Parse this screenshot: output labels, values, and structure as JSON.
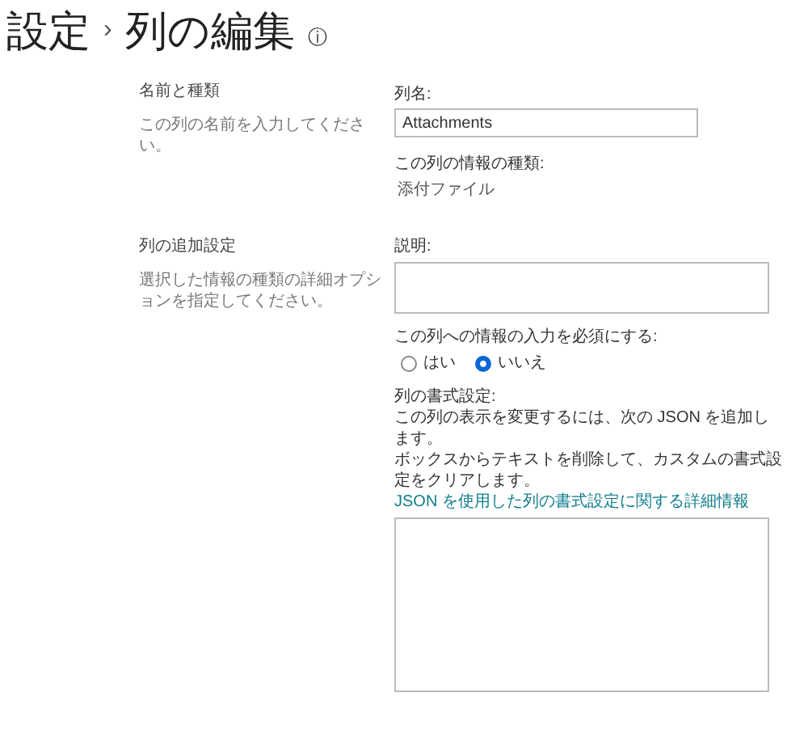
{
  "title": {
    "parent": "設定",
    "separator": "›",
    "current": "列の編集",
    "info": "ⓘ"
  },
  "sections": [
    {
      "heading": "名前と種類",
      "description": "この列の名前を入力してください。"
    },
    {
      "heading": "列の追加設定",
      "description": "選択した情報の種類の詳細オプションを指定してください。"
    }
  ],
  "column_name": {
    "label": "列名:",
    "value": "Attachments"
  },
  "column_type": {
    "label": "この列の情報の種類:",
    "value": "添付ファイル"
  },
  "description_field": {
    "label": "説明:"
  },
  "required": {
    "label": "この列への情報の入力を必須にする:",
    "options": [
      {
        "label": "はい",
        "selected": false
      },
      {
        "label": "いいえ",
        "selected": true
      }
    ]
  },
  "formatting": {
    "label": "列の書式設定:",
    "lines": [
      "この列の表示を変更するには、次の JSON を追加します。",
      "ボックスからテキストを削除して、カスタムの書式設定をクリアします。"
    ],
    "link": "JSON を使用した列の書式設定に関する詳細情報"
  }
}
